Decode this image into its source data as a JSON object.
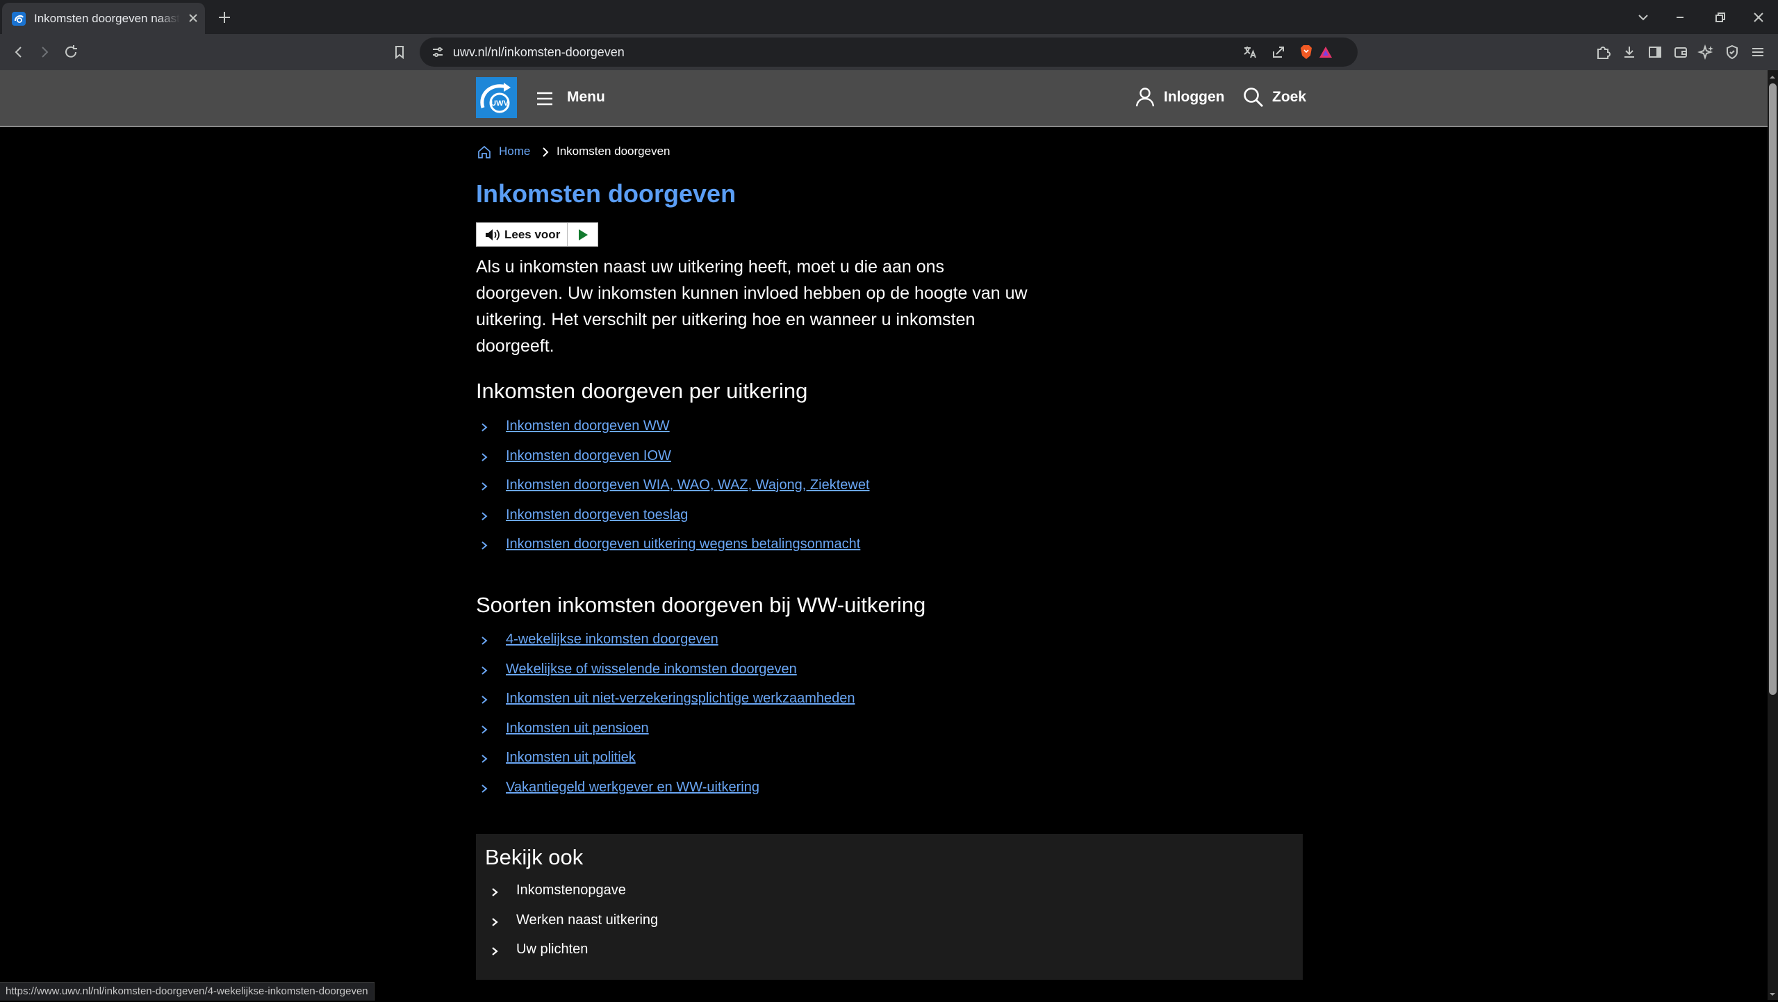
{
  "browser": {
    "tab": {
      "title": "Inkomsten doorgeven naast uw",
      "favicon": "uwv-favicon-icon"
    },
    "url": "uwv.nl/nl/inkomsten-doorgeven",
    "status_url": "https://www.uwv.nl/nl/inkomsten-doorgeven/4-wekelijkse-inkomsten-doorgeven"
  },
  "header": {
    "logo_text": "UWV",
    "menu_label": "Menu",
    "login_label": "Inloggen",
    "search_label": "Zoek"
  },
  "breadcrumb": {
    "home": "Home",
    "current": "Inkomsten doorgeven"
  },
  "page": {
    "title": "Inkomsten doorgeven",
    "read_aloud_label": "Lees voor",
    "intro": "Als u inkomsten naast uw uitkering heeft, moet u die aan ons doorgeven. Uw inkomsten kunnen invloed hebben op de hoogte van uw uitkering. Het verschilt per uitkering hoe en wanneer u inkomsten doorgeeft."
  },
  "section_per_benefit": {
    "heading": "Inkomsten doorgeven per uitkering",
    "links": [
      "Inkomsten doorgeven WW",
      "Inkomsten doorgeven IOW",
      "Inkomsten doorgeven WIA, WAO, WAZ, Wajong, Ziektewet",
      "Inkomsten doorgeven toeslag",
      "Inkomsten doorgeven uitkering wegens betalingsonmacht"
    ]
  },
  "section_ww_types": {
    "heading": "Soorten inkomsten doorgeven bij WW-uitkering",
    "links": [
      "4-wekelijkse inkomsten doorgeven",
      "Wekelijkse of wisselende inkomsten doorgeven",
      "Inkomsten uit niet-verzekeringsplichtige werkzaamheden",
      "Inkomsten uit pensioen",
      "Inkomsten uit politiek",
      "Vakantiegeld werkgever en WW-uitkering"
    ]
  },
  "see_also": {
    "heading": "Bekijk ook",
    "links": [
      "Inkomstenopgave",
      "Werken naast uitkering",
      "Uw plichten"
    ]
  },
  "colors": {
    "link": "#6aa6f4",
    "title": "#5b9ef5",
    "header_bg": "#4b4b4b",
    "logo_bg": "#1e87d8"
  }
}
